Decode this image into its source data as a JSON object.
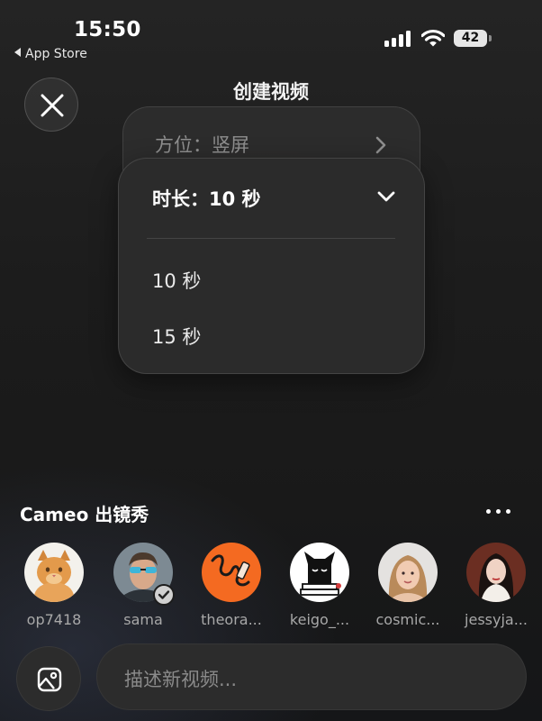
{
  "status_bar": {
    "time": "15:50",
    "back_app": "App Store",
    "battery_level": "42"
  },
  "header": {
    "title": "创建视频"
  },
  "orientation": {
    "label": "方位：竖屏"
  },
  "duration": {
    "label": "时长：10 秒",
    "options": [
      "10 秒",
      "15 秒"
    ]
  },
  "cameo": {
    "title": "Cameo 出镜秀",
    "users": [
      {
        "name": "op7418",
        "verified": false
      },
      {
        "name": "sama",
        "verified": true
      },
      {
        "name": "theora...",
        "verified": false
      },
      {
        "name": "keigo_...",
        "verified": false
      },
      {
        "name": "cosmic...",
        "verified": false
      },
      {
        "name": "jessyja...",
        "verified": false
      }
    ]
  },
  "prompt": {
    "placeholder": "描述新视频..."
  },
  "icons": [
    "close-icon",
    "chevron-right-icon",
    "chevron-down-icon",
    "more-icon",
    "image-icon",
    "signal-icon",
    "wifi-icon",
    "battery-icon"
  ],
  "colors": {
    "background": "#1c1c1c",
    "card": "#2b2b2b",
    "accent_avatar": "#f46a21",
    "muted_text": "#8a8a8a"
  }
}
